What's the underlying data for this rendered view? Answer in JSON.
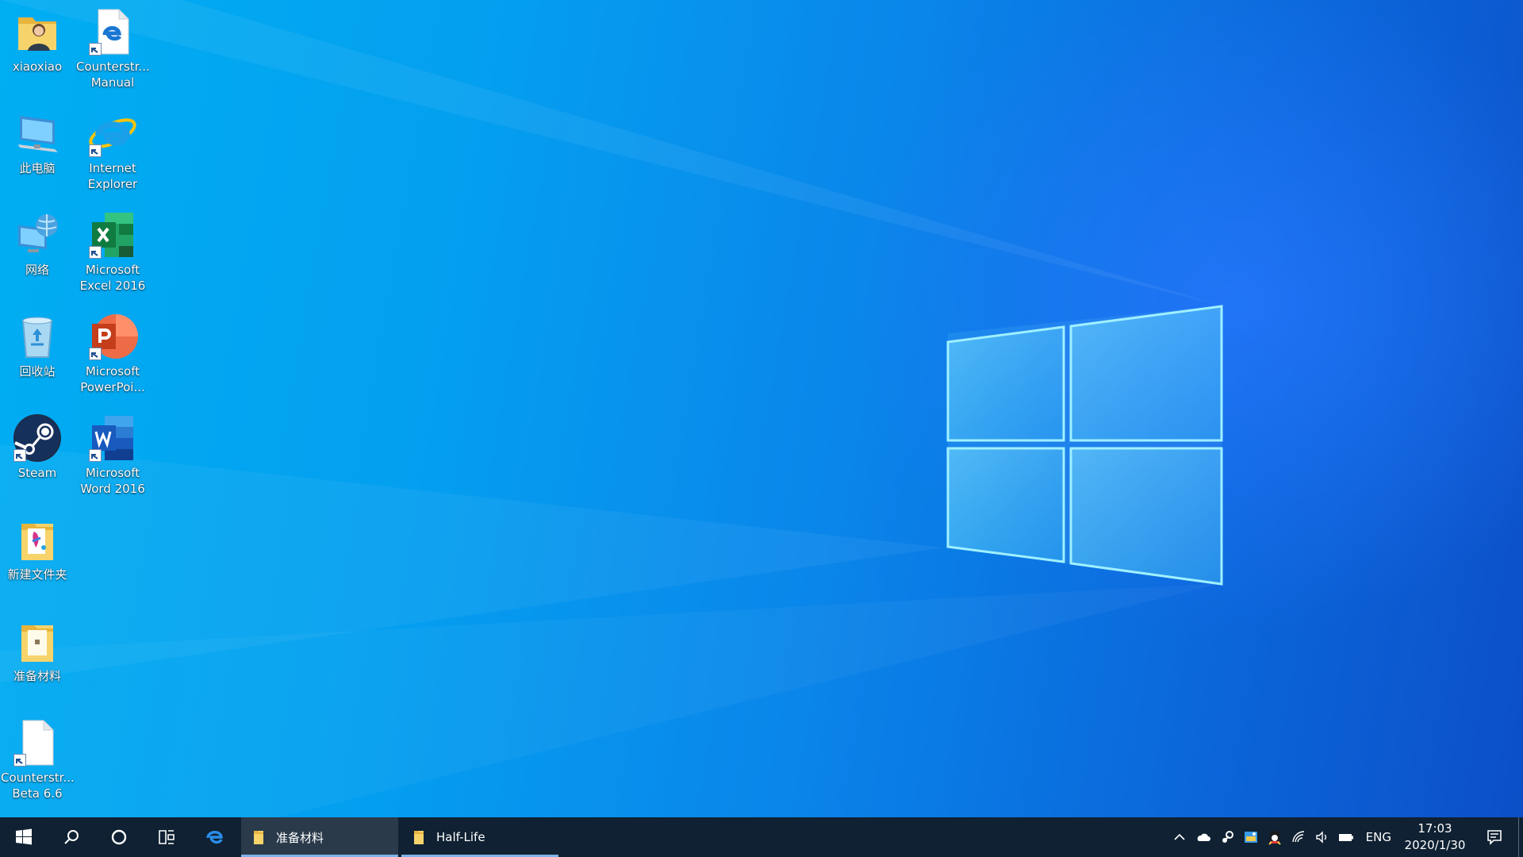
{
  "desktop": {
    "icons": [
      {
        "label": "xiaoxiao",
        "icon": "user-folder-icon"
      },
      {
        "label": "Counterstr...\nManual",
        "icon": "edge-document-icon"
      },
      {
        "label": "此电脑",
        "icon": "this-pc-icon"
      },
      {
        "label": "Internet\nExplorer",
        "icon": "internet-explorer-icon"
      },
      {
        "label": "网络",
        "icon": "network-icon"
      },
      {
        "label": "Microsoft\nExcel 2016",
        "icon": "excel-icon"
      },
      {
        "label": "回收站",
        "icon": "recycle-bin-icon"
      },
      {
        "label": "Microsoft\nPowerPoi...",
        "icon": "powerpoint-icon"
      },
      {
        "label": "Steam",
        "icon": "steam-icon"
      },
      {
        "label": "Microsoft\nWord 2016",
        "icon": "word-icon"
      },
      {
        "label": "新建文件夹",
        "icon": "folder-icon"
      },
      {
        "label": "准备材料",
        "icon": "folder-icon"
      },
      {
        "label": "Counterstr...\nBeta 6.6",
        "icon": "blank-file-icon"
      }
    ]
  },
  "taskbar": {
    "start": "windows-start-icon",
    "search": "search-icon",
    "cortana": "cortana-icon",
    "task_view": "task-view-icon",
    "pinned_edge": "edge-icon",
    "apps": [
      {
        "label": "准备材料",
        "icon": "folder-icon",
        "active": true
      },
      {
        "label": "Half-Life",
        "icon": "folder-icon",
        "active": false
      }
    ],
    "tray": {
      "icons": [
        "chevron-up-icon",
        "onedrive-icon",
        "steam-tray-icon",
        "app-tray-icon",
        "qq-tray-icon",
        "wifi-icon",
        "volume-icon",
        "battery-icon"
      ],
      "language": "ENG",
      "time": "17:03",
      "date": "2020/1/30",
      "notification": "action-center-icon"
    }
  },
  "colors": {
    "taskbar": "#0f2132",
    "wallpaper_light": "#00aef2",
    "wallpaper_dark": "#0c4fc8",
    "logo": "#5fd6ff"
  }
}
